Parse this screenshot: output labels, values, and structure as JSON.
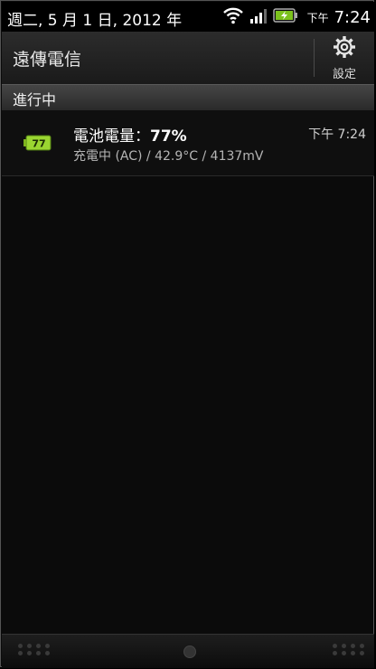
{
  "statusbar": {
    "date": "週二, 5 月 1 日, 2012 年",
    "ampm": "下午",
    "time": "7:24",
    "icons": [
      "wifi-icon",
      "signal-icon",
      "battery-charging-icon"
    ]
  },
  "header": {
    "carrier": "遠傳電信",
    "settings_label": "設定"
  },
  "section": {
    "title": "進行中"
  },
  "notification": {
    "badge": "77",
    "title_prefix": "電池電量：",
    "title_value": "77%",
    "subtitle": "充電中 (AC) / 42.9°C / 4137mV",
    "time": "下午 7:24",
    "accent": "#8ccc2a"
  }
}
